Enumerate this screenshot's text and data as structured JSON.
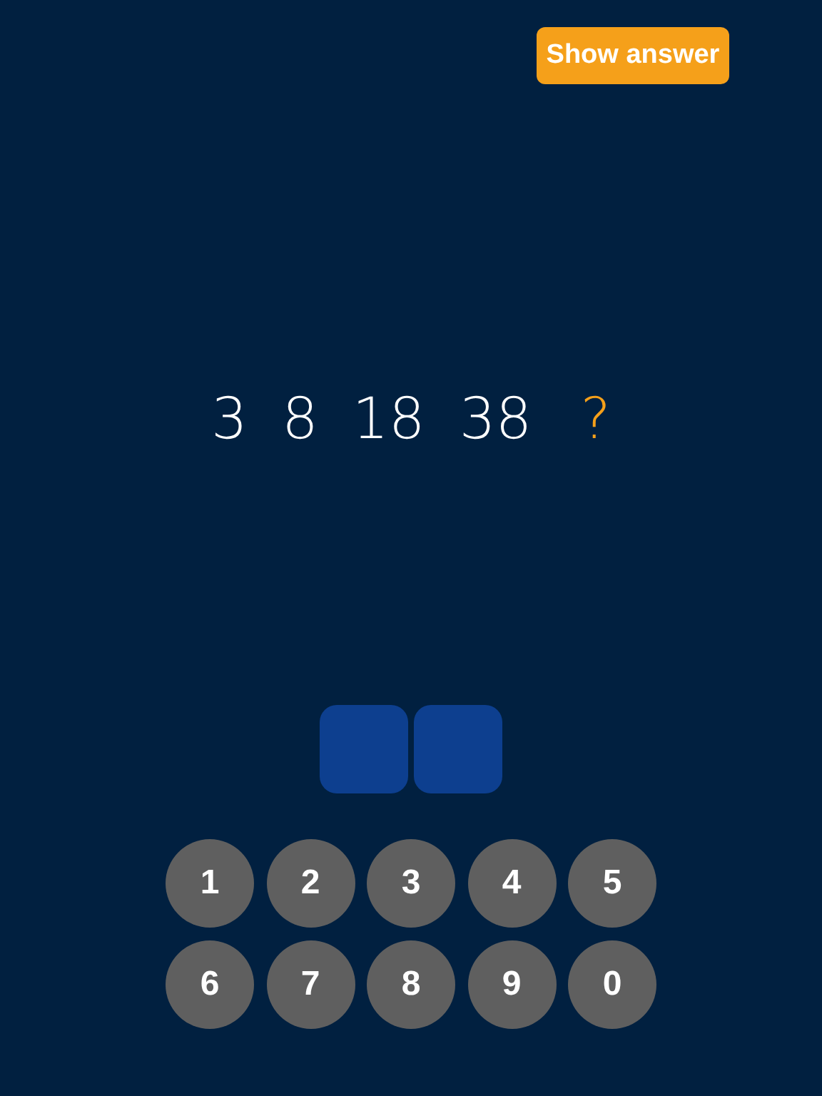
{
  "show_answer_button": {
    "label": "Show answer"
  },
  "sequence": [
    {
      "text": "3",
      "kind": "number"
    },
    {
      "text": "8",
      "kind": "number"
    },
    {
      "text": "18",
      "kind": "number"
    },
    {
      "text": "38",
      "kind": "number"
    },
    {
      "text": "?",
      "kind": "unknown"
    }
  ],
  "answer_slots": [
    {
      "filled": false
    },
    {
      "filled": false
    }
  ],
  "keypad": [
    "1",
    "2",
    "3",
    "4",
    "5",
    "6",
    "7",
    "8",
    "9",
    "0"
  ]
}
